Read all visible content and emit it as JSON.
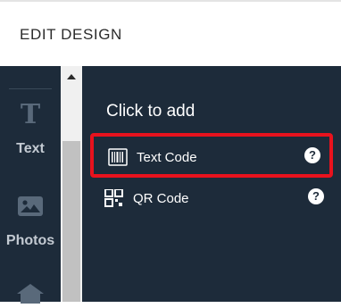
{
  "header": {
    "title": "EDIT DESIGN"
  },
  "sidebar": {
    "items": [
      {
        "label": "Text",
        "icon": "text-icon"
      },
      {
        "label": "Photos",
        "icon": "photos-icon"
      },
      {
        "label": "",
        "icon": "home-icon"
      }
    ]
  },
  "content": {
    "title": "Click to add",
    "items": [
      {
        "label": "Text Code",
        "icon": "barcode-icon",
        "help": "?"
      },
      {
        "label": "QR Code",
        "icon": "qr-code-icon",
        "help": "?"
      }
    ]
  },
  "colors": {
    "panel_bg": "#1d2b3a",
    "highlight": "#e8121d"
  }
}
